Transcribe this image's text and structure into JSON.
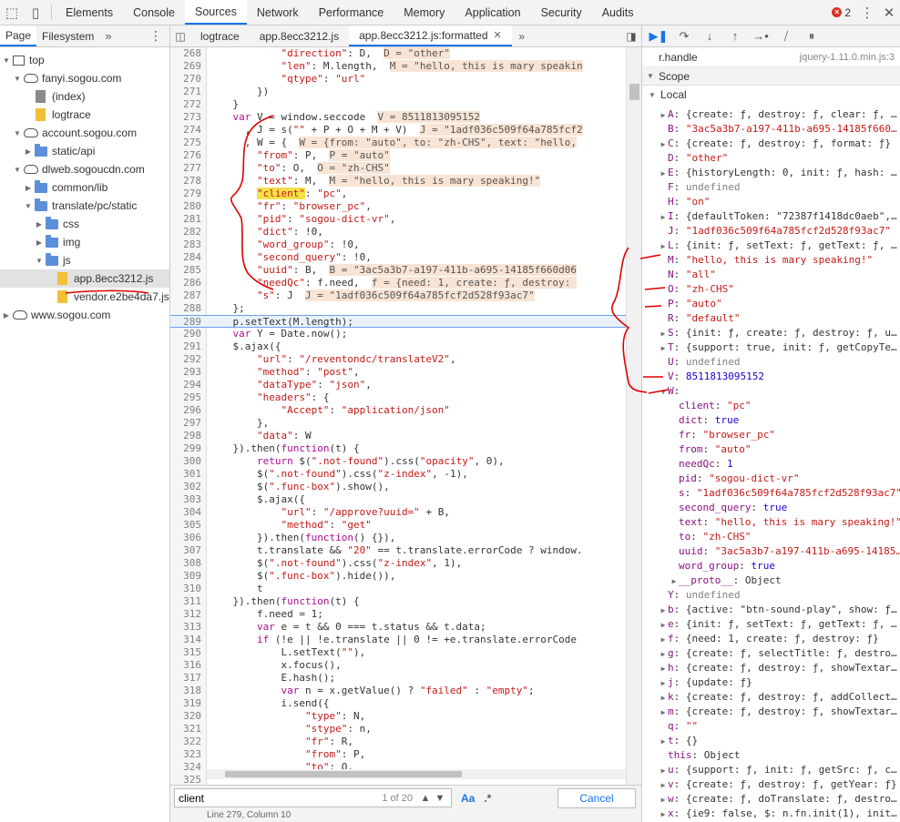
{
  "toolbar": {
    "tabs": [
      {
        "label": "Elements",
        "active": false
      },
      {
        "label": "Console",
        "active": false
      },
      {
        "label": "Sources",
        "active": true
      },
      {
        "label": "Network",
        "active": false
      },
      {
        "label": "Performance",
        "active": false
      },
      {
        "label": "Memory",
        "active": false
      },
      {
        "label": "Application",
        "active": false
      },
      {
        "label": "Security",
        "active": false
      },
      {
        "label": "Audits",
        "active": false
      }
    ],
    "error_count": "2"
  },
  "navigator": {
    "tabs": [
      "Page",
      "Filesystem"
    ],
    "tree": [
      {
        "depth": 0,
        "icon": "frame",
        "open": true,
        "label": "top"
      },
      {
        "depth": 1,
        "icon": "cloud",
        "open": true,
        "label": "fanyi.sogou.com"
      },
      {
        "depth": 2,
        "icon": "file-gray",
        "open": null,
        "label": "(index)"
      },
      {
        "depth": 2,
        "icon": "file-yellow",
        "open": null,
        "label": "logtrace"
      },
      {
        "depth": 1,
        "icon": "cloud",
        "open": true,
        "label": "account.sogou.com"
      },
      {
        "depth": 2,
        "icon": "folder",
        "open": false,
        "label": "static/api"
      },
      {
        "depth": 1,
        "icon": "cloud",
        "open": true,
        "label": "dlweb.sogoucdn.com"
      },
      {
        "depth": 2,
        "icon": "folder",
        "open": false,
        "label": "common/lib"
      },
      {
        "depth": 2,
        "icon": "folder",
        "open": true,
        "label": "translate/pc/static"
      },
      {
        "depth": 3,
        "icon": "folder",
        "open": false,
        "label": "css"
      },
      {
        "depth": 3,
        "icon": "folder",
        "open": false,
        "label": "img"
      },
      {
        "depth": 3,
        "icon": "folder",
        "open": true,
        "label": "js"
      },
      {
        "depth": 4,
        "icon": "file-yellow",
        "open": null,
        "label": "app.8ecc3212.js",
        "selected": true
      },
      {
        "depth": 4,
        "icon": "file-yellow",
        "open": null,
        "label": "vendor.e2be4da7.js"
      },
      {
        "depth": 0,
        "icon": "cloud",
        "open": false,
        "label": "www.sogou.com"
      }
    ]
  },
  "editor": {
    "tabs": [
      {
        "label": "logtrace",
        "active": false,
        "closable": false
      },
      {
        "label": "app.8ecc3212.js",
        "active": false,
        "closable": false
      },
      {
        "label": "app.8ecc3212.js:formatted",
        "active": true,
        "closable": true
      }
    ],
    "highlight_line": 289,
    "lines": [
      {
        "n": 268,
        "t": "            \"direction\": D,  D = \"other\""
      },
      {
        "n": 269,
        "t": "            \"len\": M.length,  M = \"hello, this is mary speakin"
      },
      {
        "n": 270,
        "t": "            \"qtype\": \"url\""
      },
      {
        "n": 271,
        "t": "        })"
      },
      {
        "n": 272,
        "t": "    }"
      },
      {
        "n": 273,
        "t": "    var V = window.seccode  V = 8511813095152"
      },
      {
        "n": 274,
        "t": "      , J = s(\"\" + P + O + M + V)  J = \"1adf036c509f64a785fcf2"
      },
      {
        "n": 275,
        "t": "      , W = {  W = {from: \"auto\", to: \"zh-CHS\", text: \"hello,"
      },
      {
        "n": 276,
        "t": "        \"from\": P,  P = \"auto\""
      },
      {
        "n": 277,
        "t": "        \"to\": O,  O = \"zh-CHS\""
      },
      {
        "n": 278,
        "t": "        \"text\": M,  M = \"hello, this is mary speaking!\""
      },
      {
        "n": 279,
        "t": "        \"client\": \"pc\","
      },
      {
        "n": 280,
        "t": "        \"fr\": \"browser_pc\","
      },
      {
        "n": 281,
        "t": "        \"pid\": \"sogou-dict-vr\","
      },
      {
        "n": 282,
        "t": "        \"dict\": !0,"
      },
      {
        "n": 283,
        "t": "        \"word_group\": !0,"
      },
      {
        "n": 284,
        "t": "        \"second_query\": !0,"
      },
      {
        "n": 285,
        "t": "        \"uuid\": B,  B = \"3ac5a3b7-a197-411b-a695-14185f660d06"
      },
      {
        "n": 286,
        "t": "        \"needQc\": f.need,  f = {need: 1, create: ƒ, destroy: "
      },
      {
        "n": 287,
        "t": "        \"s\": J  J = \"1adf036c509f64a785fcf2d528f93ac7\""
      },
      {
        "n": 288,
        "t": "    };"
      },
      {
        "n": 289,
        "t": "    p.setText(M.length);"
      },
      {
        "n": 290,
        "t": "    var Y = Date.now();"
      },
      {
        "n": 291,
        "t": "    $.ajax({"
      },
      {
        "n": 292,
        "t": "        \"url\": \"/reventondc/translateV2\","
      },
      {
        "n": 293,
        "t": "        \"method\": \"post\","
      },
      {
        "n": 294,
        "t": "        \"dataType\": \"json\","
      },
      {
        "n": 295,
        "t": "        \"headers\": {"
      },
      {
        "n": 296,
        "t": "            \"Accept\": \"application/json\""
      },
      {
        "n": 297,
        "t": "        },"
      },
      {
        "n": 298,
        "t": "        \"data\": W"
      },
      {
        "n": 299,
        "t": "    }).then(function(t) {"
      },
      {
        "n": 300,
        "t": "        return $(\".not-found\").css(\"opacity\", 0),"
      },
      {
        "n": 301,
        "t": "        $(\".not-found\").css(\"z-index\", -1),"
      },
      {
        "n": 302,
        "t": "        $(\".func-box\").show(),"
      },
      {
        "n": 303,
        "t": "        $.ajax({"
      },
      {
        "n": 304,
        "t": "            \"url\": \"/approve?uuid=\" + B,"
      },
      {
        "n": 305,
        "t": "            \"method\": \"get\""
      },
      {
        "n": 306,
        "t": "        }).then(function() {}),"
      },
      {
        "n": 307,
        "t": "        t.translate && \"20\" == t.translate.errorCode ? window."
      },
      {
        "n": 308,
        "t": "        $(\".not-found\").css(\"z-index\", 1),"
      },
      {
        "n": 309,
        "t": "        $(\".func-box\").hide()),"
      },
      {
        "n": 310,
        "t": "        t"
      },
      {
        "n": 311,
        "t": "    }).then(function(t) {"
      },
      {
        "n": 312,
        "t": "        f.need = 1;"
      },
      {
        "n": 313,
        "t": "        var e = t && 0 === t.status && t.data;"
      },
      {
        "n": 314,
        "t": "        if (!e || !e.translate || 0 != +e.translate.errorCode"
      },
      {
        "n": 315,
        "t": "            L.setText(\"\"),"
      },
      {
        "n": 316,
        "t": "            x.focus(),"
      },
      {
        "n": 317,
        "t": "            E.hash();"
      },
      {
        "n": 318,
        "t": "            var n = x.getValue() ? \"failed\" : \"empty\";"
      },
      {
        "n": 319,
        "t": "            i.send({"
      },
      {
        "n": 320,
        "t": "                \"type\": N,"
      },
      {
        "n": 321,
        "t": "                \"stype\": n,"
      },
      {
        "n": 322,
        "t": "                \"fr\": R,"
      },
      {
        "n": 323,
        "t": "                \"from\": P,"
      },
      {
        "n": 324,
        "t": "                \"to\": O,"
      },
      {
        "n": 325,
        "t": ""
      }
    ]
  },
  "search": {
    "query": "client",
    "count": "1 of 20",
    "case_option": "Aa",
    "regex_option": ".*",
    "cancel_label": "Cancel"
  },
  "statusbar": {
    "text": "Line 279, Column 10"
  },
  "debugger": {
    "callframe": {
      "name": "r.handle",
      "source": "jquery-1.11.0.min.js:3"
    },
    "scope_title": "Scope",
    "local_title": "Local",
    "vars": [
      {
        "indent": 1,
        "tri": "closed",
        "name": "A",
        "value": "{create: ƒ, destroy: ƒ, clear: ƒ, …",
        "kind": "obj"
      },
      {
        "indent": 1,
        "tri": null,
        "name": "B",
        "value": "\"3ac5a3b7-a197-411b-a695-14185f660…",
        "kind": "str"
      },
      {
        "indent": 1,
        "tri": "closed",
        "name": "C",
        "value": "{create: ƒ, destroy: ƒ, format: ƒ}",
        "kind": "obj"
      },
      {
        "indent": 1,
        "tri": null,
        "name": "D",
        "value": "\"other\"",
        "kind": "str"
      },
      {
        "indent": 1,
        "tri": "closed",
        "name": "E",
        "value": "{historyLength: 0, init: ƒ, hash: …",
        "kind": "obj"
      },
      {
        "indent": 1,
        "tri": null,
        "name": "F",
        "value": "undefined",
        "kind": "undef"
      },
      {
        "indent": 1,
        "tri": null,
        "name": "H",
        "value": "\"on\"",
        "kind": "str"
      },
      {
        "indent": 1,
        "tri": "closed",
        "name": "I",
        "value": "{defaultToken: \"72387f1418dc0aeb\",…",
        "kind": "obj"
      },
      {
        "indent": 1,
        "tri": null,
        "name": "J",
        "value": "\"1adf036c509f64a785fcf2d528f93ac7\"",
        "kind": "str"
      },
      {
        "indent": 1,
        "tri": "closed",
        "name": "L",
        "value": "{init: ƒ, setText: ƒ, getText: ƒ, …",
        "kind": "obj"
      },
      {
        "indent": 1,
        "tri": null,
        "name": "M",
        "value": "\"hello, this is mary speaking!\"",
        "kind": "str"
      },
      {
        "indent": 1,
        "tri": null,
        "name": "N",
        "value": "\"all\"",
        "kind": "str"
      },
      {
        "indent": 1,
        "tri": null,
        "name": "O",
        "value": "\"zh-CHS\"",
        "kind": "str"
      },
      {
        "indent": 1,
        "tri": null,
        "name": "P",
        "value": "\"auto\"",
        "kind": "str"
      },
      {
        "indent": 1,
        "tri": null,
        "name": "R",
        "value": "\"default\"",
        "kind": "str"
      },
      {
        "indent": 1,
        "tri": "closed",
        "name": "S",
        "value": "{init: ƒ, create: ƒ, destroy: ƒ, u…",
        "kind": "obj"
      },
      {
        "indent": 1,
        "tri": "closed",
        "name": "T",
        "value": "{support: true, init: ƒ, getCopyTe…",
        "kind": "obj"
      },
      {
        "indent": 1,
        "tri": null,
        "name": "U",
        "value": "undefined",
        "kind": "undef"
      },
      {
        "indent": 1,
        "tri": null,
        "name": "V",
        "value": "8511813095152",
        "kind": "num"
      },
      {
        "indent": 1,
        "tri": "open",
        "name": "W",
        "value": "",
        "kind": "obj"
      },
      {
        "indent": 2,
        "tri": null,
        "name": "client",
        "value": "\"pc\"",
        "kind": "str"
      },
      {
        "indent": 2,
        "tri": null,
        "name": "dict",
        "value": "true",
        "kind": "num"
      },
      {
        "indent": 2,
        "tri": null,
        "name": "fr",
        "value": "\"browser_pc\"",
        "kind": "str"
      },
      {
        "indent": 2,
        "tri": null,
        "name": "from",
        "value": "\"auto\"",
        "kind": "str"
      },
      {
        "indent": 2,
        "tri": null,
        "name": "needQc",
        "value": "1",
        "kind": "num"
      },
      {
        "indent": 2,
        "tri": null,
        "name": "pid",
        "value": "\"sogou-dict-vr\"",
        "kind": "str"
      },
      {
        "indent": 2,
        "tri": null,
        "name": "s",
        "value": "\"1adf036c509f64a785fcf2d528f93ac7\"",
        "kind": "str"
      },
      {
        "indent": 2,
        "tri": null,
        "name": "second_query",
        "value": "true",
        "kind": "num"
      },
      {
        "indent": 2,
        "tri": null,
        "name": "text",
        "value": "\"hello, this is mary speaking!\"",
        "kind": "str"
      },
      {
        "indent": 2,
        "tri": null,
        "name": "to",
        "value": "\"zh-CHS\"",
        "kind": "str"
      },
      {
        "indent": 2,
        "tri": null,
        "name": "uuid",
        "value": "\"3ac5a3b7-a197-411b-a695-14185…",
        "kind": "str"
      },
      {
        "indent": 2,
        "tri": null,
        "name": "word_group",
        "value": "true",
        "kind": "num"
      },
      {
        "indent": 2,
        "tri": "closed",
        "name": "__proto__",
        "value": "Object",
        "kind": "obj"
      },
      {
        "indent": 1,
        "tri": null,
        "name": "Y",
        "value": "undefined",
        "kind": "undef"
      },
      {
        "indent": 1,
        "tri": "closed",
        "name": "b",
        "value": "{active: \"btn-sound-play\", show: ƒ…",
        "kind": "obj"
      },
      {
        "indent": 1,
        "tri": "closed",
        "name": "e",
        "value": "{init: ƒ, setText: ƒ, getText: ƒ, …",
        "kind": "obj"
      },
      {
        "indent": 1,
        "tri": "closed",
        "name": "f",
        "value": "{need: 1, create: ƒ, destroy: ƒ}",
        "kind": "obj"
      },
      {
        "indent": 1,
        "tri": "closed",
        "name": "g",
        "value": "{create: ƒ, selectTitle: ƒ, destro…",
        "kind": "obj"
      },
      {
        "indent": 1,
        "tri": "closed",
        "name": "h",
        "value": "{create: ƒ, destroy: ƒ, showTextar…",
        "kind": "obj"
      },
      {
        "indent": 1,
        "tri": "closed",
        "name": "j",
        "value": "{update: ƒ}",
        "kind": "obj"
      },
      {
        "indent": 1,
        "tri": "closed",
        "name": "k",
        "value": "{create: ƒ, destroy: ƒ, addCollect…",
        "kind": "obj"
      },
      {
        "indent": 1,
        "tri": "closed",
        "name": "m",
        "value": "{create: ƒ, destroy: ƒ, showTextar…",
        "kind": "obj"
      },
      {
        "indent": 1,
        "tri": null,
        "name": "q",
        "value": "\"\"",
        "kind": "str"
      },
      {
        "indent": 1,
        "tri": "closed",
        "name": "t",
        "value": "{}",
        "kind": "obj"
      },
      {
        "indent": 1,
        "tri": null,
        "name": "this",
        "value": "Object",
        "kind": "obj"
      },
      {
        "indent": 1,
        "tri": "closed",
        "name": "u",
        "value": "{support: ƒ, init: ƒ, getSrc: ƒ, c…",
        "kind": "obj"
      },
      {
        "indent": 1,
        "tri": "closed",
        "name": "v",
        "value": "{create: ƒ, destroy: ƒ, getYear: ƒ}",
        "kind": "obj"
      },
      {
        "indent": 1,
        "tri": "closed",
        "name": "w",
        "value": "{create: ƒ, doTranslate: ƒ, destro…",
        "kind": "obj"
      },
      {
        "indent": 1,
        "tri": "closed",
        "name": "x",
        "value": "{ie9: false, $: n.fn.init(1), init…",
        "kind": "obj"
      }
    ]
  },
  "colors": {
    "accent": "#1a73e8",
    "annotation": "#e00000",
    "inline_value_bg": "#f8e4d4",
    "search_match": "#f5e14a"
  }
}
